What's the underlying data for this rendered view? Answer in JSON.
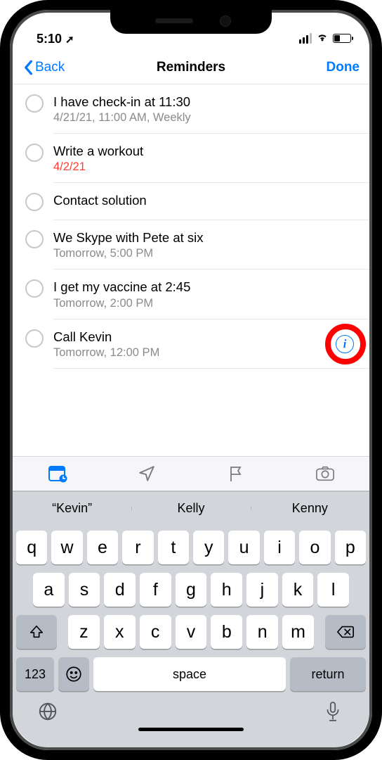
{
  "status": {
    "time": "5:10",
    "location_arrow": "↗"
  },
  "nav": {
    "back": "Back",
    "title": "Reminders",
    "done": "Done"
  },
  "reminders": [
    {
      "title": "I have check-in at 11:30",
      "sub": "4/21/21, 11:00 AM, Weekly",
      "overdue": false
    },
    {
      "title": "Write a workout",
      "sub": "4/2/21",
      "overdue": true
    },
    {
      "title": "Contact solution",
      "sub": "",
      "overdue": false
    },
    {
      "title": "We Skype with Pete at six",
      "sub": "Tomorrow, 5:00 PM",
      "overdue": false
    },
    {
      "title": "I get my vaccine at 2:45",
      "sub": "Tomorrow, 2:00 PM",
      "overdue": false
    },
    {
      "title": "Call Kevin",
      "sub": "Tomorrow, 12:00 PM",
      "overdue": false,
      "info": true,
      "highlight": true
    }
  ],
  "suggestions": [
    "“Kevin”",
    "Kelly",
    "Kenny"
  ],
  "keyboard": {
    "row1": [
      "q",
      "w",
      "e",
      "r",
      "t",
      "y",
      "u",
      "i",
      "o",
      "p"
    ],
    "row2": [
      "a",
      "s",
      "d",
      "f",
      "g",
      "h",
      "j",
      "k",
      "l"
    ],
    "row3": [
      "z",
      "x",
      "c",
      "v",
      "b",
      "n",
      "m"
    ],
    "num": "123",
    "space": "space",
    "ret": "return"
  }
}
